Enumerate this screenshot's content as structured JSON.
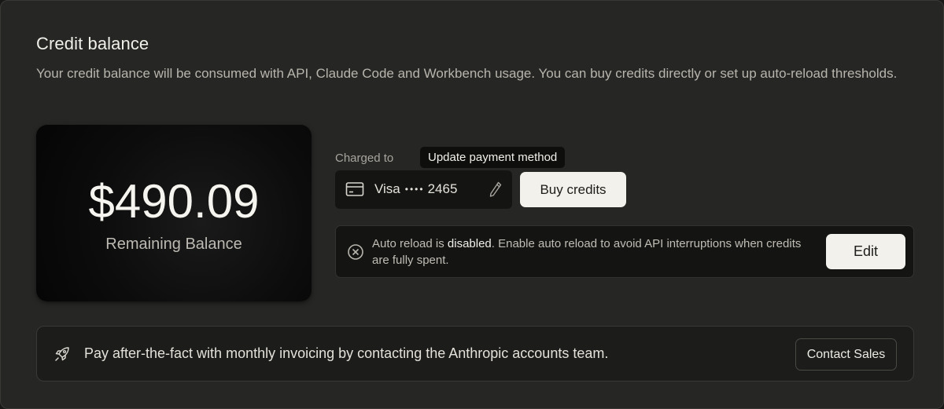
{
  "section": {
    "title": "Credit balance",
    "description": "Your credit balance will be consumed with API, Claude Code and Workbench usage. You can buy credits directly or set up auto-reload thresholds."
  },
  "balance": {
    "amount": "$490.09",
    "label": "Remaining Balance"
  },
  "payment": {
    "charged_label": "Charged to",
    "tooltip": "Update payment method",
    "card_brand": "Visa",
    "card_mask": "••••",
    "card_last4": "2465",
    "icon": "credit-card-icon",
    "edit_icon": "pencil-icon"
  },
  "buy_button": "Buy credits",
  "auto_reload": {
    "text_prefix": "Auto reload is ",
    "status": "disabled",
    "text_suffix": ". Enable auto reload to avoid API interruptions when credits are fully spent.",
    "icon": "x-circle-icon",
    "edit_label": "Edit"
  },
  "invoice": {
    "icon": "rocket-icon",
    "text": "Pay after-the-fact with monthly invoicing by contacting the Anthropic accounts team.",
    "contact_label": "Contact Sales"
  },
  "colors": {
    "panel_bg": "#262624",
    "card_bg": "#0C0C0C",
    "button_bg": "#F3F1EB",
    "dark_box_bg": "#141413"
  }
}
